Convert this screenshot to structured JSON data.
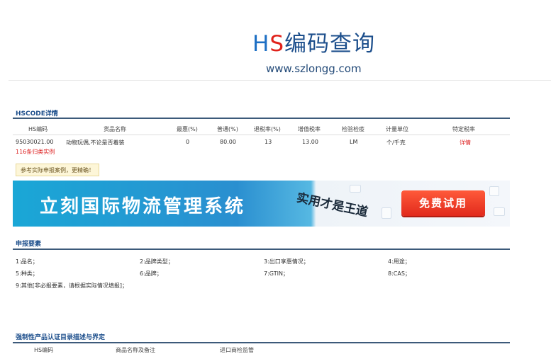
{
  "header": {
    "logo_h": "H",
    "logo_s": "S",
    "logo_rest": "编码查询",
    "site": "www.szlongg.com"
  },
  "detail": {
    "title": "HSCODE详情",
    "columns": [
      "HS编码",
      "货品名称",
      "最惠(%)",
      "普通(%)",
      "退税率(%)",
      "增值税率",
      "检验检疫",
      "计量单位",
      "特定税率"
    ],
    "row": {
      "hs_code": "95030021.00",
      "name": "动物玩偶,不论是否着装",
      "mfn": "0",
      "general": "80.00",
      "rebate": "13",
      "vat": "13.00",
      "inspection": "LM",
      "unit": "个/千克",
      "special": "详情",
      "cases": "116条归类实例"
    },
    "tip": "参考实际申报案例，更精确！"
  },
  "banner": {
    "text": "立刻国际物流管理系统",
    "slogan": "实用才是王道",
    "button": "免费试用"
  },
  "declaration": {
    "title": "申报要素",
    "items": [
      "1:品名；",
      "2:品牌类型；",
      "3:出口享惠情况；",
      "4:用途；",
      "5:种类；",
      "6:品牌；",
      "7:GTIN；",
      "8:CAS；",
      "9:其他[非必报要素，请根据实际情况填报]；"
    ]
  },
  "certification": {
    "title": "强制性产品认证目录描述与界定",
    "columns": [
      "HS编码",
      "商品名称及备注",
      "进口商检监管"
    ]
  },
  "colors": {
    "accent": "#1d4f8c",
    "link_red": "#dd2222",
    "banner_blue": "#1aa7d6",
    "button_red": "#e12a1c"
  }
}
